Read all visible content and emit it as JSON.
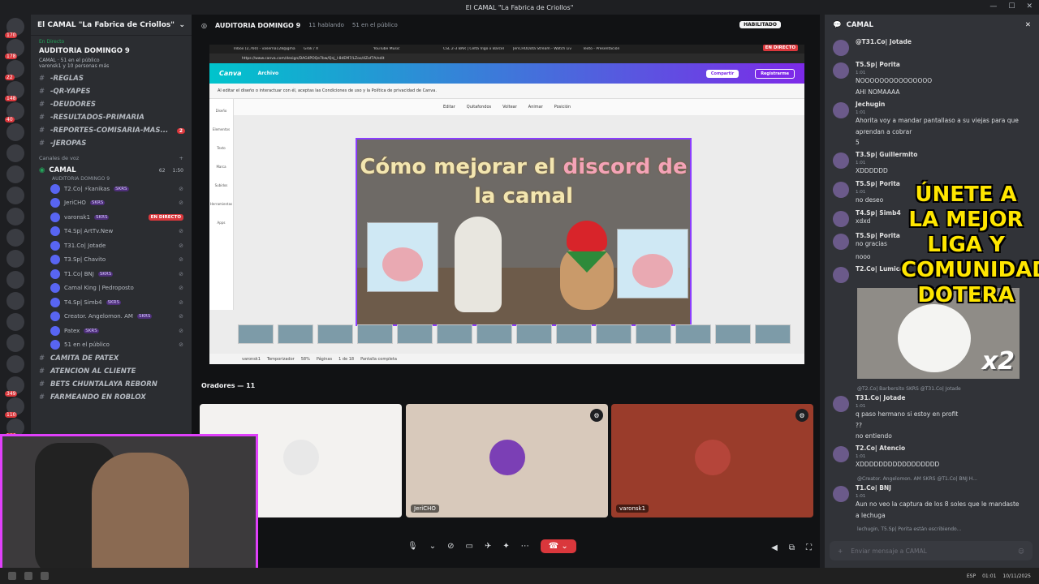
{
  "window": {
    "title": "El CAMAL \"La Fabrica de Criollos\""
  },
  "server": {
    "name": "El CAMAL \"La Fabrica de Criollos\""
  },
  "guild_badges": [
    "170",
    "178",
    "22",
    "148",
    "40",
    "",
    "",
    "",
    "",
    "",
    "",
    "",
    "",
    "",
    "",
    "",
    "",
    "349",
    "110",
    "106"
  ],
  "live": {
    "status": "En Directo",
    "title": "AUDITORIA DOMINGO 9",
    "sub1": "CAMAL · 51 en el público",
    "sub2": "varonsk1 y 10 personas más"
  },
  "channels": [
    {
      "label": "-REGLAS",
      "badge": ""
    },
    {
      "label": "-QR-YAPES",
      "badge": ""
    },
    {
      "label": "-DEUDORES",
      "badge": ""
    },
    {
      "label": "-RESULTADOS-PRIMARIA",
      "badge": ""
    },
    {
      "label": "-REPORTES-COMISARIA-MAS...",
      "badge": "2"
    },
    {
      "label": "-JEROPAS",
      "badge": ""
    }
  ],
  "voice_category": "Canales de voz",
  "voice_channel": {
    "name": "CAMAL",
    "count": "62",
    "extra": "1:50",
    "sub": "AUDITORIA DOMINGO 9"
  },
  "voice_users": [
    {
      "name": "T2.Co| ⚡kanikas",
      "tag": "SKRS",
      "live": ""
    },
    {
      "name": "JeriCHO",
      "tag": "SKRS",
      "live": ""
    },
    {
      "name": "varonsk1",
      "tag": "SKRS",
      "live": "EN DIRECTO"
    },
    {
      "name": "T4.Sp| ArtTv.New",
      "tag": "",
      "live": ""
    },
    {
      "name": "T31.Co| Jotade",
      "tag": "",
      "live": ""
    },
    {
      "name": "T3.Sp| Chavito",
      "tag": "",
      "live": ""
    },
    {
      "name": "T1.Co| BNJ",
      "tag": "SKRS",
      "live": ""
    },
    {
      "name": "Camal King | Pedroposto",
      "tag": "",
      "live": ""
    },
    {
      "name": "T4.Sp| Simb4",
      "tag": "SKRS",
      "live": ""
    },
    {
      "name": "Creator. Angelomon. AM",
      "tag": "SKRS",
      "live": ""
    },
    {
      "name": "Patex",
      "tag": "SKRS",
      "live": ""
    },
    {
      "name": "51 en el público",
      "tag": "",
      "live": ""
    }
  ],
  "channels2": [
    {
      "label": "CAMITA DE PATEX"
    },
    {
      "label": "ATENCION AL CLIENTE"
    },
    {
      "label": "BETS CHUNTALAYA REBORN"
    },
    {
      "label": "FARMEANDO EN ROBLOX"
    }
  ],
  "main_header": {
    "title": "AUDITORIA DOMINGO 9",
    "talking": "11 hablando",
    "public": "51 en el público",
    "habilitado": "HABILITADO"
  },
  "stream": {
    "en_directo": "EN DIRECTO",
    "tabs": [
      "Inbox (2,760) - vaserna128@gma",
      "Grok / X",
      "YouTube Music",
      "CSL 2-3 BAR | Celta Vigo x Barcel",
      "JeriCHODota Stream - Watch Liv",
      "Texto - Presentación"
    ],
    "url": "https://www.canva.com/design/DAG4POQe7bw/Qnj_l-8dEM7/LZoo/4Zof7A/edit",
    "canva_logo": "Canva",
    "archivo": "Archivo",
    "share": "Compartir",
    "register": "Registrarme",
    "notice": "Al editar el diseño o interactuar con él, aceptas las Condiciones de uso y la Política de privacidad de Canva.",
    "tools": [
      "Editar",
      "Quitafondos",
      "Voltear",
      "Animar",
      "Posición"
    ],
    "left_tools": [
      "Diseño",
      "Elementos",
      "Texto",
      "Marca",
      "Subidos",
      "Herramientas",
      "Apps"
    ],
    "slide_title_1": "Cómo mejorar el ",
    "slide_title_2": "discord de",
    "slide_title_3": "la camal",
    "status": [
      "varonsk1",
      "Temporizador",
      "58%",
      "Páginas",
      "1 de 18",
      "Pantalla completa"
    ]
  },
  "oradores": "Oradores — 11",
  "tiles": [
    {
      "name": "kanikas",
      "color": "#f3f2f0"
    },
    {
      "name": "JeriCHO",
      "color": "#d8c9bb"
    },
    {
      "name": "varonsk1",
      "color": "#9a3c2b"
    }
  ],
  "chat": {
    "channel": "CAMAL",
    "composer_placeholder": "Enviar mensaje a CAMAL",
    "overlay": "ÚNETE A LA MEJOR LIGA Y COMUNIDAD DOTERA",
    "cat_badge": "x2",
    "messages": [
      {
        "user": "@T31.Co| Jotade",
        "time": "",
        "text": "",
        "cont": []
      },
      {
        "user": "T5.Sp| Porita",
        "time": "1:01",
        "text": "NOOOOOOOOOOOOOOO",
        "cont": [
          "AHI NOMAAAA"
        ]
      },
      {
        "user": "Jechugin",
        "time": "1:01",
        "text": "Ahorita voy a mandar pantallaso a su viejas para que",
        "cont": [
          "aprendan a cobrar",
          "5"
        ]
      },
      {
        "user": "T3.Sp| Guillermito",
        "time": "1:01",
        "text": "XDDDDDD",
        "cont": []
      },
      {
        "user": "T5.Sp| Porita",
        "time": "1:01",
        "text": "no deseo",
        "cont": []
      },
      {
        "user": "T4.Sp| Simb4",
        "time": "",
        "text": "xdxd",
        "cont": []
      },
      {
        "user": "T5.Sp| Porita",
        "time": "",
        "text": "no gracias",
        "cont": [
          "nooo"
        ]
      },
      {
        "user": "T2.Co| Lumica",
        "time": "",
        "text": "",
        "cont": []
      }
    ],
    "reply1": "@T2.Co| Barbersito SKRS @T31.Co| Jotade",
    "messages2": [
      {
        "user": "T31.Co| Jotade",
        "time": "1:01",
        "text": "q paso hermano si estoy en profit",
        "cont": [
          "??",
          "no entiendo"
        ]
      },
      {
        "user": "T2.Co| Atencio",
        "time": "1:01",
        "text": "XDDDDDDDDDDDDDDDDD",
        "cont": []
      }
    ],
    "reply2": "@Creator. Angelomon. AM SKRS @T1.Co| BNJ H...",
    "messages3": [
      {
        "user": "T1.Co| BNJ",
        "time": "1:01",
        "text": "Aun no veo la captura de los 8 soles que le mandaste",
        "cont": [
          "a lechuga"
        ]
      }
    ],
    "typing": "lechugin, T5.Sp| Porita están escribiendo..."
  },
  "taskbar": {
    "lang": "ESP",
    "time": "01:01",
    "date": "10/11/2025"
  }
}
